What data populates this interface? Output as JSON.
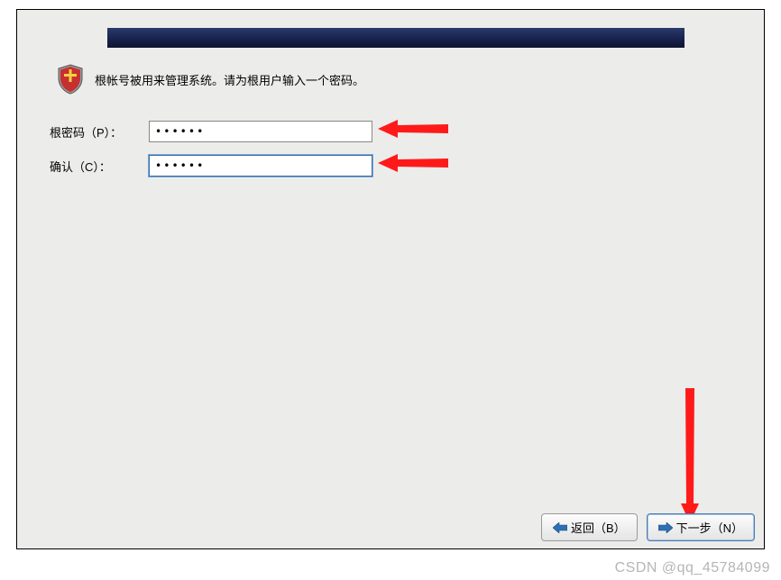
{
  "intro": {
    "text": "根帐号被用来管理系统。请为根用户输入一个密码。"
  },
  "form": {
    "password_label": "根密码（P）：",
    "confirm_label": "确认（C）：",
    "password_value": "••••••",
    "confirm_value": "••••••"
  },
  "buttons": {
    "back_label": "返回（B）",
    "next_label": "下一步（N）"
  },
  "icons": {
    "shield": "shield-icon",
    "arrow_left": "arrow-left-icon",
    "arrow_right": "arrow-right-icon"
  },
  "colors": {
    "banner_dark": "#1a2450",
    "arrow_red": "#ff1a1a",
    "button_blue": "#2f6fb3"
  },
  "watermark": "CSDN @qq_45784099"
}
